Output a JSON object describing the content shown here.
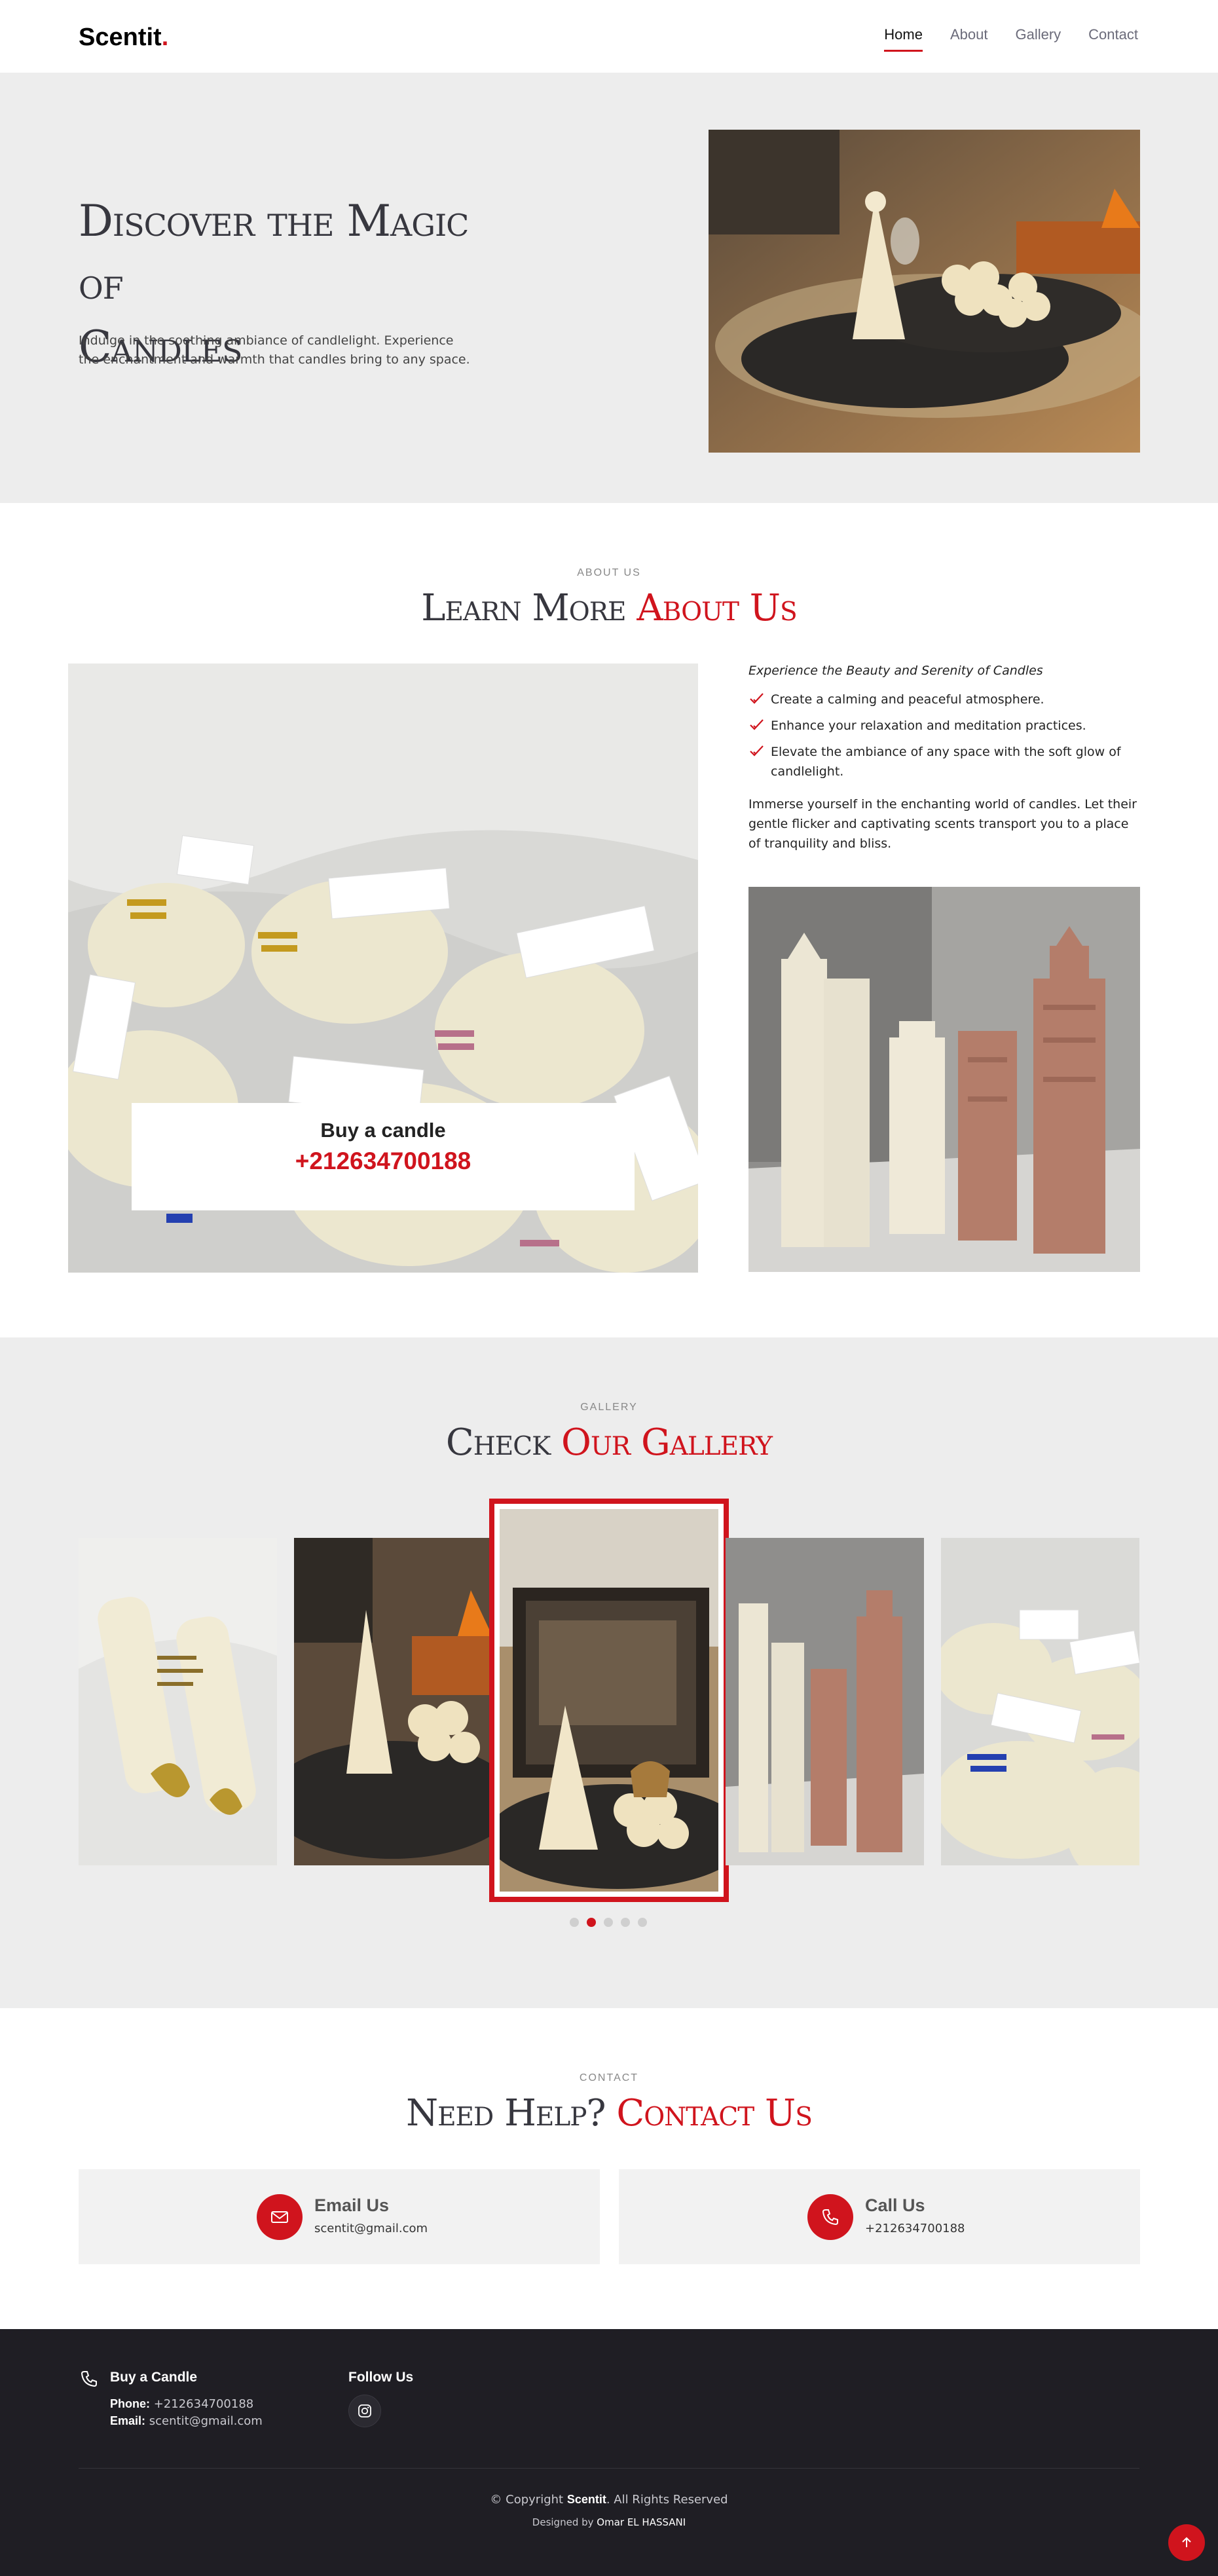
{
  "header": {
    "logo_text": "Scentit",
    "logo_dot": ".",
    "nav": [
      {
        "label": "Home",
        "active": true
      },
      {
        "label": "About",
        "active": false
      },
      {
        "label": "Gallery",
        "active": false
      },
      {
        "label": "Contact",
        "active": false
      }
    ]
  },
  "hero": {
    "title_line1": "Discover the Magic of",
    "title_line2": "Candles",
    "text": "Indulge in the soothing ambiance of candlelight. Experience the enchantment and warmth that candles bring to any space."
  },
  "about": {
    "label": "ABOUT US",
    "title_plain": "Learn More ",
    "title_accent": "About Us",
    "buy_title": "Buy a candle",
    "buy_phone": "+212634700188",
    "lead": "Experience the Beauty and Serenity of Candles",
    "points": [
      "Create a calming and peaceful atmosphere.",
      "Enhance your relaxation and meditation practices.",
      "Elevate the ambiance of any space with the soft glow of candlelight."
    ],
    "paragraph": "Immerse yourself in the enchanting world of candles. Let their gentle flicker and captivating scents transport you to a place of tranquility and bliss."
  },
  "gallery": {
    "label": "GALLERY",
    "title_plain": "Check ",
    "title_accent": "Our Gallery",
    "active_dot": 1,
    "dot_count": 5
  },
  "contact": {
    "label": "CONTACT",
    "title_plain": "Need Help? ",
    "title_accent": "Contact Us",
    "email_title": "Email Us",
    "email_value": "scentit@gmail.com",
    "call_title": "Call Us",
    "call_value": "+212634700188"
  },
  "footer": {
    "buy_heading": "Buy a Candle",
    "phone_label": "Phone:",
    "phone_value": " +212634700188",
    "email_label": "Email:",
    "email_value": " scentit@gmail.com",
    "follow_heading": "Follow Us",
    "copy_prefix": "© Copyright ",
    "copy_brand": "Scentit",
    "copy_suffix": ". All Rights Reserved",
    "designed_prefix": "Designed by ",
    "designer": "Omar EL HASSANI"
  },
  "colors": {
    "accent": "#d0141d",
    "section_bg": "#ededed",
    "footer_bg": "#1f1e24"
  },
  "icons": [
    "check-icon",
    "envelope-icon",
    "phone-icon",
    "instagram-icon",
    "arrow-up-icon"
  ]
}
